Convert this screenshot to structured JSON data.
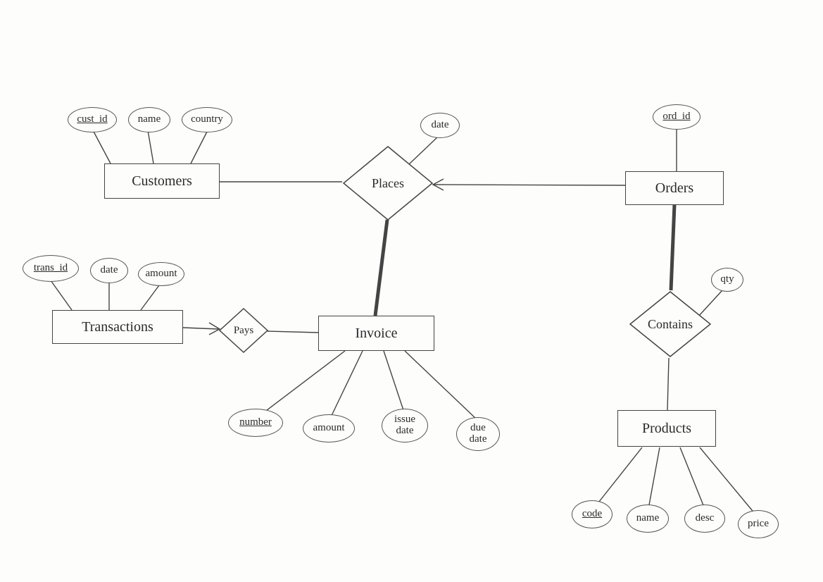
{
  "diagram": {
    "entities": {
      "customers": "Customers",
      "orders": "Orders",
      "transactions": "Transactions",
      "invoice": "Invoice",
      "products": "Products"
    },
    "relationships": {
      "places": "Places",
      "pays": "Pays",
      "contains": "Contains"
    },
    "attributes": {
      "customers": {
        "cust_id": "cust_id",
        "name": "name",
        "country": "country"
      },
      "orders": {
        "ord_id": "ord_id"
      },
      "places": {
        "date": "date"
      },
      "transactions": {
        "trans_id": "trans_id",
        "date": "date",
        "amount": "amount"
      },
      "invoice": {
        "number": "number",
        "amount": "amount",
        "issue_date": "issue\ndate",
        "due_date": "due\ndate"
      },
      "contains": {
        "qty": "qty"
      },
      "products": {
        "code": "code",
        "name": "name",
        "desc": "desc",
        "price": "price"
      }
    }
  }
}
